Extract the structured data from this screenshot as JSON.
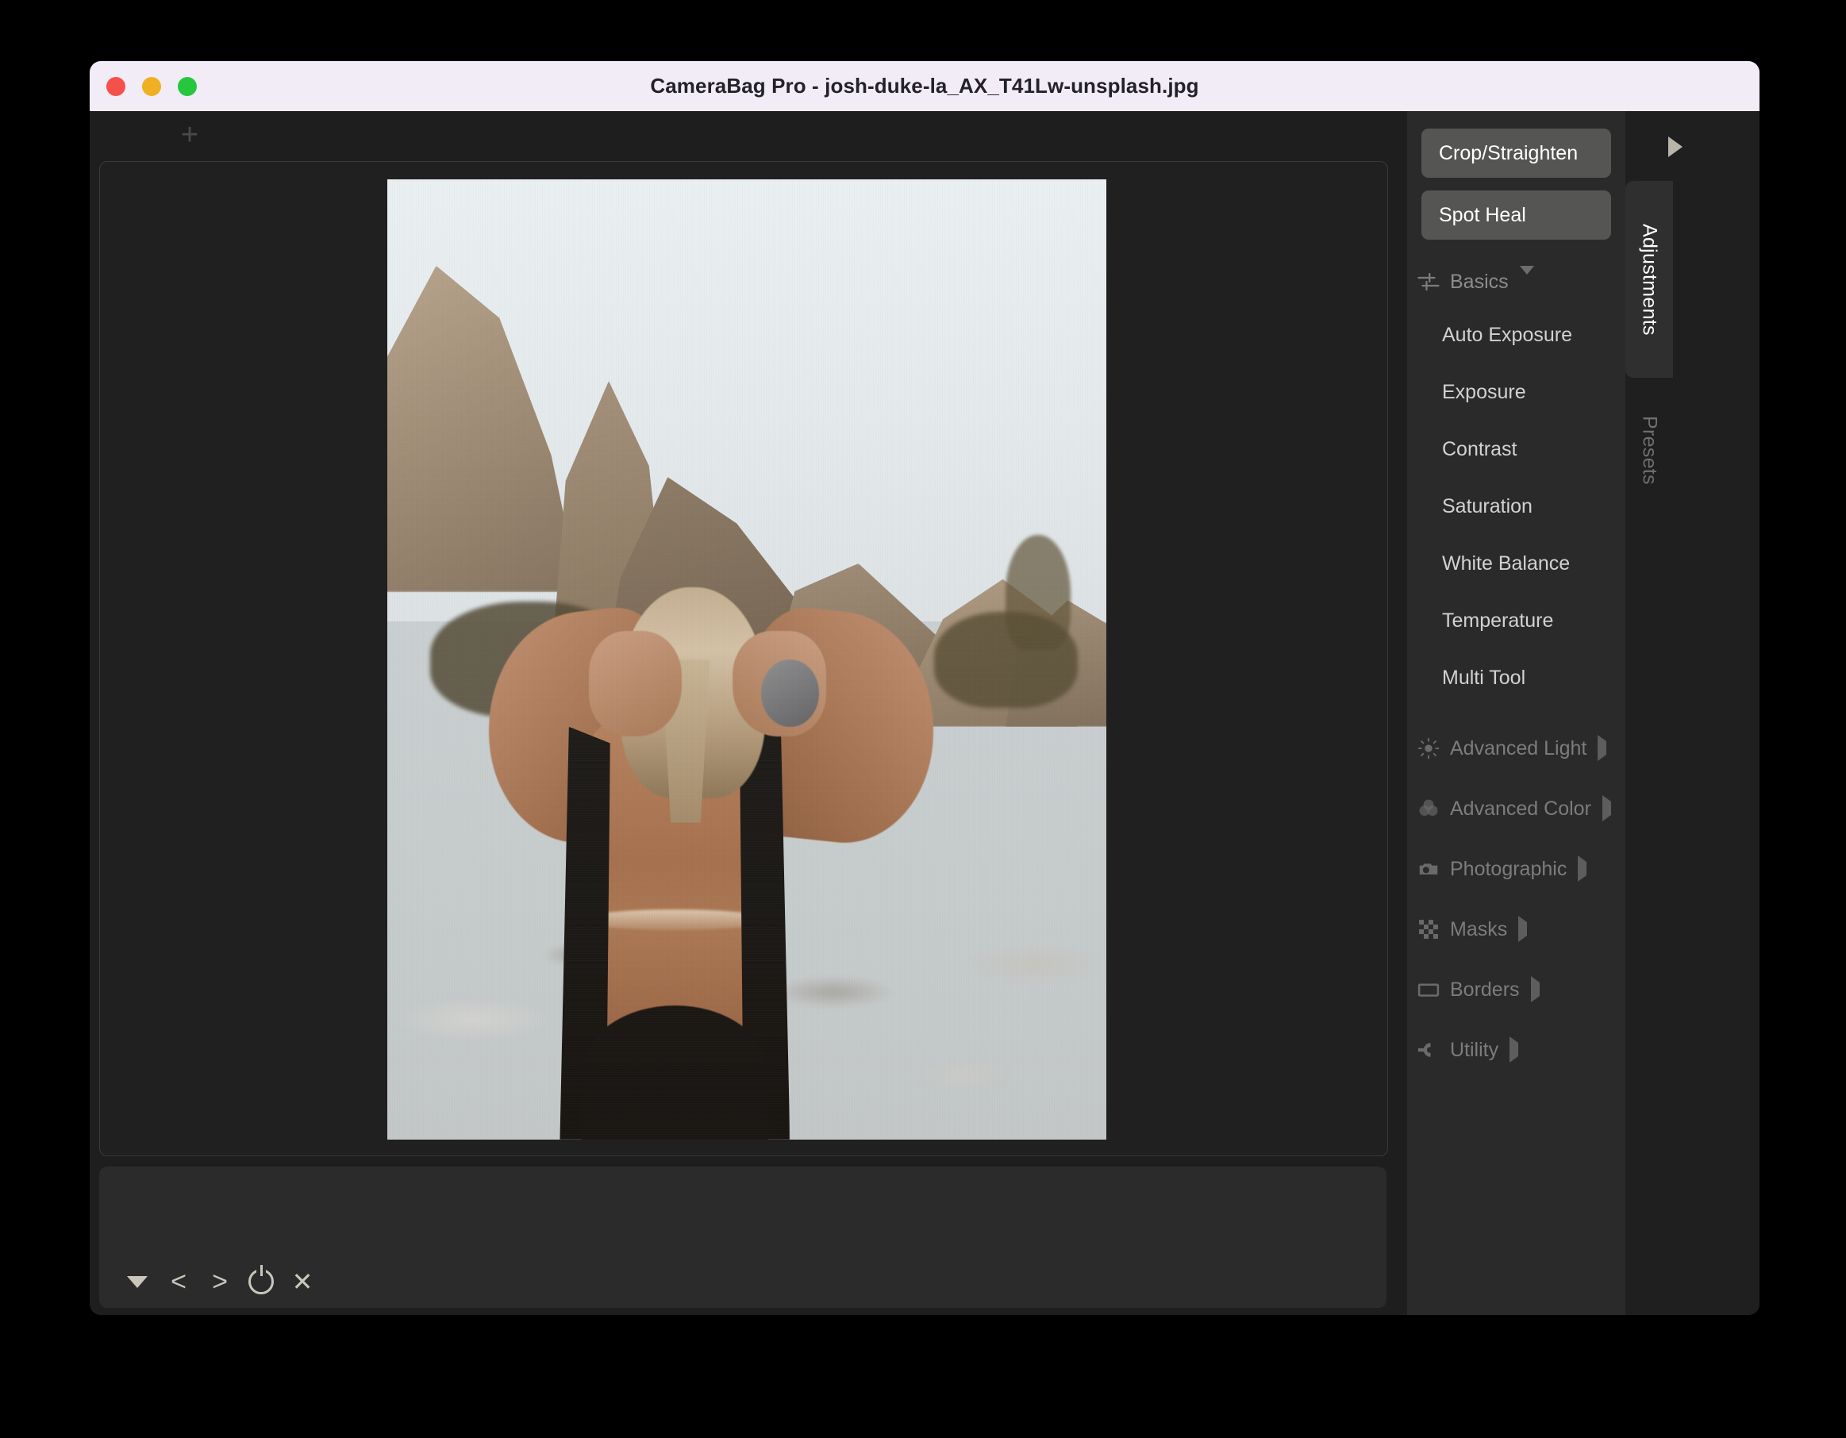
{
  "window": {
    "title": "CameraBag Pro - josh-duke-la_AX_T41Lw-unsplash.jpg",
    "traffic_lights": [
      {
        "name": "close",
        "color": "#f5504a"
      },
      {
        "name": "minimize",
        "color": "#f0b024"
      },
      {
        "name": "zoom",
        "color": "#27c63f"
      }
    ]
  },
  "toolbar": {
    "add_label": "+"
  },
  "canvas": {
    "photo_alt": "Woman from behind in black swimsuit with hands in blonde hair, desert rock formations and pale sky"
  },
  "filmstrip": {
    "buttons": [
      {
        "name": "expand-filmstrip",
        "icon": "triangle-down-icon",
        "glyph": ""
      },
      {
        "name": "previous-image",
        "icon": "chevron-left-icon",
        "glyph": "<"
      },
      {
        "name": "next-image",
        "icon": "chevron-right-icon",
        "glyph": ">"
      },
      {
        "name": "toggle-original",
        "icon": "power-icon",
        "glyph": ""
      },
      {
        "name": "close-image",
        "icon": "close-icon",
        "glyph": "✕"
      }
    ]
  },
  "adjustments": {
    "tools": [
      {
        "label": "Crop/Straighten"
      },
      {
        "label": "Spot Heal"
      }
    ],
    "sections": [
      {
        "label": "Basics",
        "icon": "sliders-icon",
        "expanded": true,
        "items": [
          {
            "label": "Auto Exposure"
          },
          {
            "label": "Exposure"
          },
          {
            "label": "Contrast"
          },
          {
            "label": "Saturation"
          },
          {
            "label": "White Balance"
          },
          {
            "label": "Temperature"
          },
          {
            "label": "Multi Tool"
          }
        ]
      },
      {
        "label": "Advanced Light",
        "icon": "sun-icon",
        "expanded": false,
        "items": []
      },
      {
        "label": "Advanced Color",
        "icon": "color-circles-icon",
        "expanded": false,
        "items": []
      },
      {
        "label": "Photographic",
        "icon": "camera-icon",
        "expanded": false,
        "items": []
      },
      {
        "label": "Masks",
        "icon": "checkerboard-icon",
        "expanded": false,
        "items": []
      },
      {
        "label": "Borders",
        "icon": "rectangle-icon",
        "expanded": false,
        "items": []
      },
      {
        "label": "Utility",
        "icon": "wrench-icon",
        "expanded": false,
        "items": []
      }
    ]
  },
  "rail": {
    "expand_icon": "triangle-right-icon",
    "tabs": [
      {
        "label": "Adjustments",
        "active": true
      },
      {
        "label": "Presets",
        "active": false
      }
    ]
  },
  "colors": {
    "titlebar_bg": "#f2ecf7",
    "window_bg": "#1e1e1e",
    "panel_bg": "#2a2a2a",
    "rail_bg": "#1f1f1f",
    "button_bg": "#555554",
    "active_tab_bg": "#2f2f2f",
    "text_primary": "#d2d2d2",
    "text_dim": "#7c7c7c"
  }
}
